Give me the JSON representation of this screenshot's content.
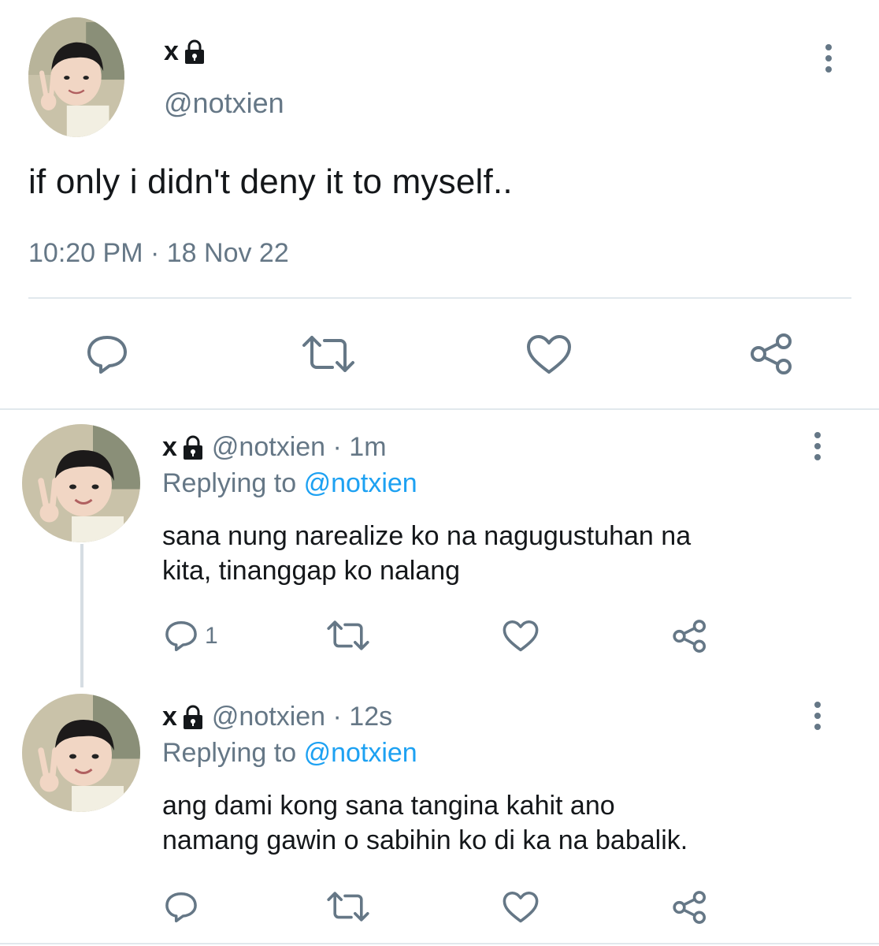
{
  "colors": {
    "text_primary": "#14171a",
    "text_secondary": "#657786",
    "accent_link": "#1da1f2",
    "divider": "#e1e8ed"
  },
  "main_tweet": {
    "author_name": "x",
    "author_handle": "@notxien",
    "text": "if only i didn't deny it to myself..",
    "timestamp": "10:20 PM · 18 Nov 22",
    "icons": [
      "lock-icon",
      "more-options-icon",
      "reply-icon",
      "retweet-icon",
      "like-icon",
      "share-icon"
    ]
  },
  "replies": [
    {
      "author_name": "x",
      "meta": "@notxien · 1m",
      "replying_prefix": "Replying to",
      "replying_to": "@notxien",
      "text_line1": "sana nung narealize ko na nagugustuhan na",
      "text_line2": "kita, tinanggap ko nalang",
      "reply_count": "1"
    },
    {
      "author_name": "x",
      "meta": "@notxien · 12s",
      "replying_prefix": "Replying to",
      "replying_to": "@notxien",
      "text_line1": "ang dami kong sana tangina kahit ano",
      "text_line2": "namang gawin o sabihin ko di ka na babalik.",
      "reply_count": ""
    }
  ]
}
